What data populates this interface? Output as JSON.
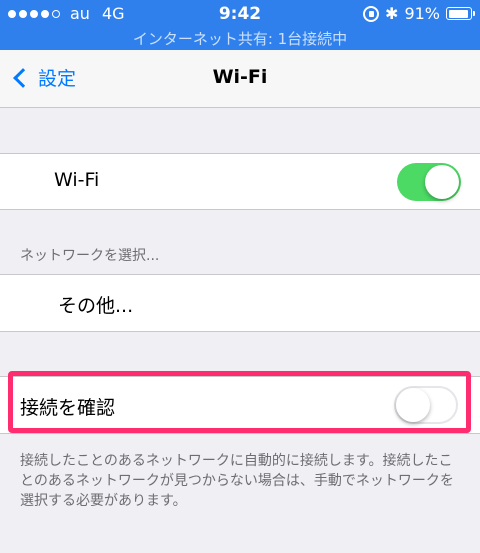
{
  "status_bar": {
    "carrier": "au",
    "network": "4G",
    "time": "9:42",
    "battery": "91%",
    "battery_level": 0.91,
    "hotspot_text": "インターネット共有: 1台接続中"
  },
  "nav": {
    "back_label": "設定",
    "title": "Wi-Fi"
  },
  "wifi": {
    "label": "Wi-Fi",
    "enabled": true
  },
  "network_section": {
    "header": "ネットワークを選択...",
    "other_label": "その他..."
  },
  "ask_to_join": {
    "label": "接続を確認",
    "enabled": false,
    "footer": "接続したことのあるネットワークに自動的に接続します。接続したことのあるネットワークが見つからない場合は、手動でネットワークを選択する必要があります。"
  },
  "colors": {
    "status_bar": "#2f80ed",
    "tint": "#007aff",
    "switch_on": "#4cd964",
    "highlight": "#ff2d6f"
  }
}
